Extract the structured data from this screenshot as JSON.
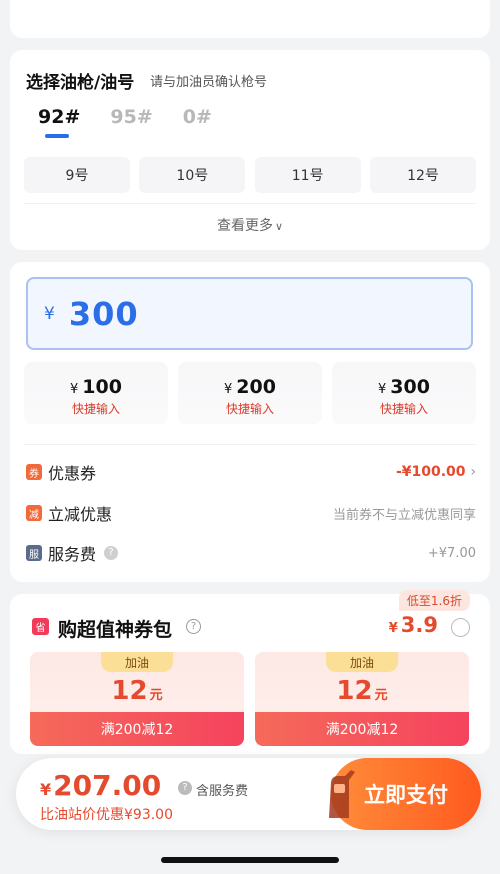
{
  "gun_section": {
    "title": "选择油枪/油号",
    "subtitle": "请与加油员确认枪号",
    "grades": [
      {
        "label": "92#",
        "active": true
      },
      {
        "label": "95#",
        "active": false
      },
      {
        "label": "0#",
        "active": false
      }
    ],
    "nozzles": [
      "9号",
      "10号",
      "11号",
      "12号"
    ],
    "see_more": "查看更多"
  },
  "amount_section": {
    "currency": "¥",
    "value": "300",
    "quick_options": [
      {
        "currency": "¥",
        "amount": "100",
        "label": "快捷输入"
      },
      {
        "currency": "¥",
        "amount": "200",
        "label": "快捷输入"
      },
      {
        "currency": "¥",
        "amount": "300",
        "label": "快捷输入"
      }
    ],
    "coupon": {
      "tag": "券",
      "label": "优惠券",
      "value": "-¥100.00"
    },
    "instant": {
      "tag": "减",
      "label": "立减优惠",
      "value": "当前券不与立减优惠同享"
    },
    "service": {
      "tag": "服",
      "label": "服务费",
      "value": "+¥7.00"
    }
  },
  "pack_section": {
    "badge": "低至1.6折",
    "icon_text": "省",
    "title": "购超值神券包",
    "currency": "¥",
    "price": "3.9",
    "coupons": [
      {
        "type": "加油",
        "value": "12",
        "unit": "元",
        "condition": "满200减12"
      },
      {
        "type": "加油",
        "value": "12",
        "unit": "元",
        "condition": "满200减12"
      }
    ]
  },
  "pay_bar": {
    "currency": "¥",
    "total": "207.00",
    "service_note": "含服务费",
    "compare": "比油站价优惠¥93.00",
    "button": "立即支付"
  },
  "colors": {
    "accent_blue": "#2b6fe8",
    "accent_red": "#e64a2e",
    "pay_orange": "#ff6a26"
  }
}
